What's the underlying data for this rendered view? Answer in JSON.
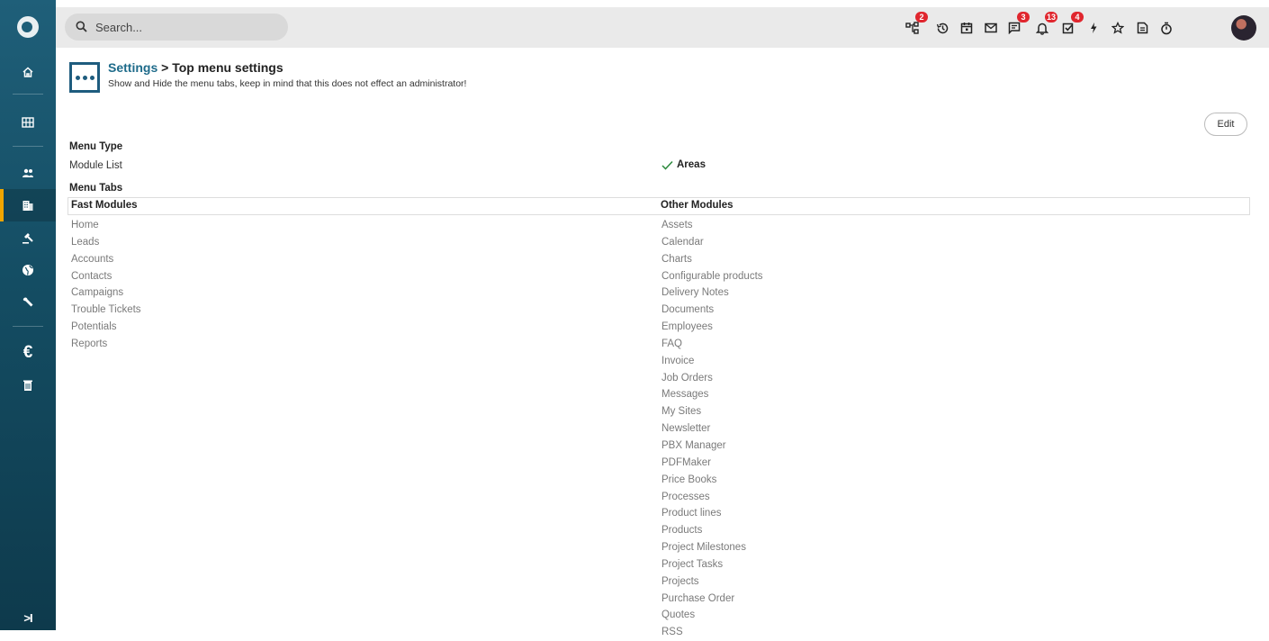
{
  "search": {
    "placeholder": "Search..."
  },
  "sidebar": {
    "items": [
      {
        "name": "home-icon"
      },
      {
        "name": "grid-icon"
      },
      {
        "name": "contacts-icon"
      },
      {
        "name": "building-icon",
        "active": true
      },
      {
        "name": "gavel-icon"
      },
      {
        "name": "globe-icon"
      },
      {
        "name": "wrench-icon"
      },
      {
        "name": "euro-icon",
        "glyph": "€"
      },
      {
        "name": "trash-icon"
      }
    ],
    "expand_glyph": ">I"
  },
  "topbar": {
    "icons": [
      {
        "name": "hierarchy-icon",
        "badge": "2"
      },
      {
        "name": "history-icon",
        "badge": ""
      },
      {
        "name": "calendar-icon",
        "badge": ""
      },
      {
        "name": "mail-icon",
        "badge": ""
      },
      {
        "name": "chat-icon",
        "badge": "3"
      },
      {
        "name": "bell-icon",
        "badge": "13"
      },
      {
        "name": "task-icon",
        "badge": "4"
      },
      {
        "name": "lightning-icon",
        "badge": ""
      },
      {
        "name": "star-icon",
        "badge": ""
      },
      {
        "name": "document-icon",
        "badge": ""
      },
      {
        "name": "timer-icon",
        "badge": ""
      }
    ]
  },
  "header": {
    "breadcrumb_link": "Settings",
    "breadcrumb_sep": " > ",
    "breadcrumb_current": "Top menu settings",
    "subtitle": "Show and Hide the menu tabs, keep in mind that this does not effect an administrator!"
  },
  "edit_label": "Edit",
  "menu_type": {
    "heading": "Menu Type",
    "label": "Module List",
    "selected": "Areas"
  },
  "menu_tabs": {
    "heading": "Menu Tabs",
    "fast_header": "Fast Modules",
    "other_header": "Other Modules",
    "fast": [
      "Home",
      "Leads",
      "Accounts",
      "Contacts",
      "Campaigns",
      "Trouble Tickets",
      "Potentials",
      "Reports"
    ],
    "other": [
      "Assets",
      "Calendar",
      "Charts",
      "Configurable products",
      "Delivery Notes",
      "Documents",
      "Employees",
      "FAQ",
      "Invoice",
      "Job Orders",
      "Messages",
      "My Sites",
      "Newsletter",
      "PBX Manager",
      "PDFMaker",
      "Price Books",
      "Processes",
      "Product lines",
      "Products",
      "Project Milestones",
      "Project Tasks",
      "Projects",
      "Purchase Order",
      "Quotes",
      "RSS"
    ]
  },
  "colors": {
    "sidebar_top": "#1f5f79",
    "sidebar_bottom": "#0e3a4c",
    "accent": "#f0a500",
    "link": "#1e6b8a",
    "badge": "#e0262e"
  }
}
